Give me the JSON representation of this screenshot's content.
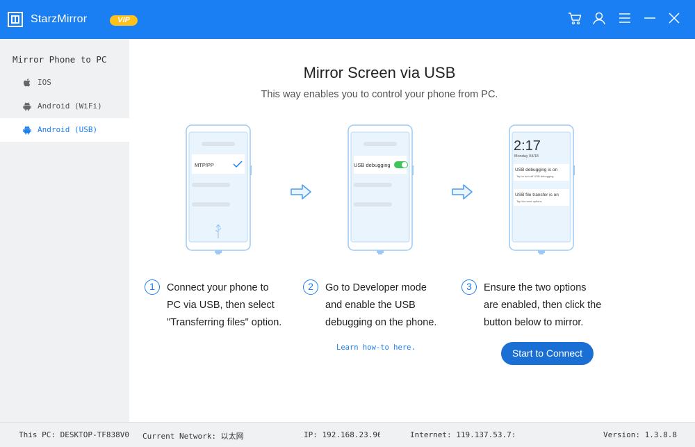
{
  "titlebar": {
    "app_name": "StarzMirror",
    "vip_label": "VIP",
    "icons": [
      "cart-icon",
      "user-icon",
      "menu-icon",
      "minimize-icon",
      "close-icon"
    ]
  },
  "sidebar": {
    "title": "Mirror Phone to PC",
    "items": [
      {
        "label": "IOS",
        "icon": "apple-icon",
        "active": false
      },
      {
        "label": "Android (WiFi)",
        "icon": "android-icon",
        "active": false
      },
      {
        "label": "Android (USB)",
        "icon": "android-icon",
        "active": true
      }
    ]
  },
  "main": {
    "title": "Mirror Screen via USB",
    "subtitle": "This way enables you to control your phone from PC.",
    "phones": {
      "p1": {
        "option_label": "MTP/PP"
      },
      "p2": {
        "option_label": "USB debugging"
      },
      "p3": {
        "time": "2:17",
        "date": "Monday 04/18",
        "notif1_title": "USB debugging is on",
        "notif1_sub": "Tap to turn off USB debugging",
        "notif2_title": "USB file transfer is on",
        "notif2_sub": "Tap for more options"
      }
    },
    "steps": [
      {
        "num": "1",
        "line1": "Connect your phone to",
        "line2": "PC via USB, then select",
        "line3": "\"Transferring files\" option."
      },
      {
        "num": "2",
        "line1": "Go to Developer mode",
        "line2": "and enable the USB",
        "line3": "debugging on the phone."
      },
      {
        "num": "3",
        "line1": "Ensure the two options",
        "line2": "are enabled, then click the",
        "line3": "button below to mirror."
      }
    ],
    "learn_link": "Learn how-to here.",
    "connect_button": "Start to Connect"
  },
  "statusbar": {
    "this_pc": "This PC: DESKTOP-TF838V0",
    "network": "Current Network: 以太网",
    "ip": "IP: 192.168.23.96",
    "internet": "Internet: 119.137.53.7:",
    "version": "Version: 1.3.8.8"
  },
  "colors": {
    "accent": "#1a7ff2",
    "vip": "#ffc21a",
    "sidebar_bg": "#f0f1f3",
    "toggle_on": "#3dc45a"
  }
}
